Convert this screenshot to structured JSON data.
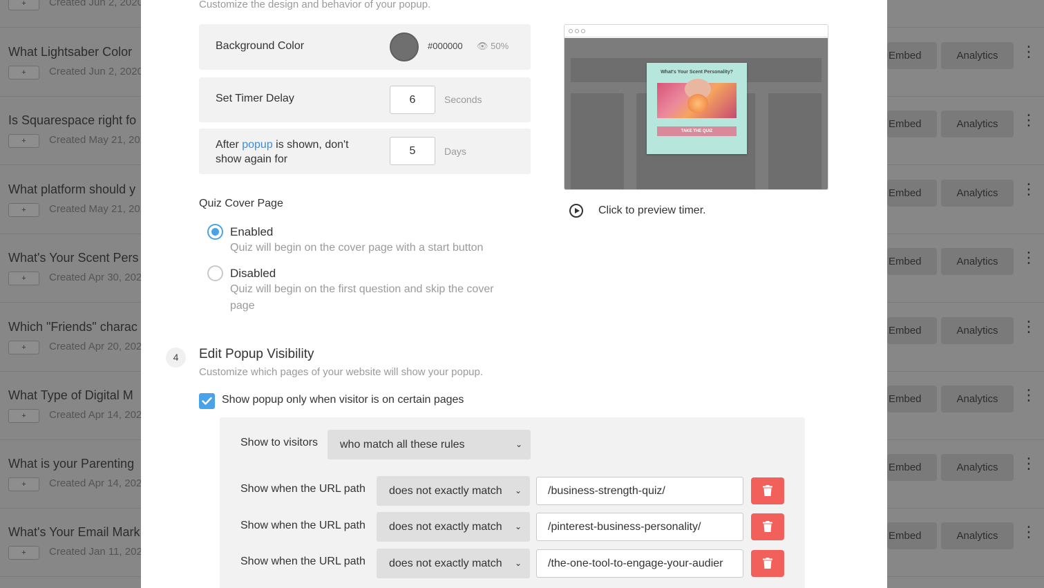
{
  "background_list": {
    "rows": [
      {
        "title": "",
        "tag": "+",
        "created": "Created Jun 2, 2020",
        "embed": "",
        "analytics": ""
      },
      {
        "title": "What Lightsaber Color",
        "tag": "+",
        "created": "Created Jun 2, 2020",
        "embed": "Embed",
        "analytics": "Analytics"
      },
      {
        "title": "Is Squarespace right fo",
        "tag": "+",
        "created": "Created May 21, 202",
        "embed": "Embed",
        "analytics": "Analytics"
      },
      {
        "title": "What platform should y",
        "tag": "+",
        "created": "Created May 21, 202",
        "embed": "Embed",
        "analytics": "Analytics"
      },
      {
        "title": "What's Your Scent Pers",
        "tag": "+",
        "created": "Created Apr 30, 202",
        "embed": "Embed",
        "analytics": "Analytics"
      },
      {
        "title": "Which \"Friends\" charac",
        "tag": "+",
        "created": "Created Apr 20, 202",
        "embed": "Embed",
        "analytics": "Analytics"
      },
      {
        "title": "What Type of Digital M",
        "tag": "+",
        "created": "Created Apr 14, 202",
        "embed": "Embed",
        "analytics": "Analytics"
      },
      {
        "title": "What is your Parenting",
        "tag": "+",
        "created": "Created Apr 14, 202",
        "embed": "Embed",
        "analytics": "Analytics"
      },
      {
        "title": "What's Your Email Mark",
        "tag": "+",
        "created": "Created Jan 11, 2020",
        "embed": "Embed",
        "analytics": "Analytics"
      }
    ],
    "more_icon": "vertical-dots-icon"
  },
  "design": {
    "subtitle": "Customize the design and behavior of your popup.",
    "background_color": {
      "label": "Background Color",
      "hex": "#000000",
      "opacity": "50%",
      "swatch_color": "#6f6f6f"
    },
    "timer_delay": {
      "label": "Set Timer Delay",
      "value": "6",
      "unit": "Seconds"
    },
    "show_again": {
      "label_before": "After ",
      "label_link": "popup",
      "label_after": " is shown, don't show again for",
      "value": "5",
      "unit": "Days"
    },
    "cover_page": {
      "label": "Quiz Cover Page",
      "enabled": {
        "title": "Enabled",
        "desc": "Quiz will begin on the cover page with a start button"
      },
      "disabled": {
        "title": "Disabled",
        "desc": "Quiz will begin on the first question and skip the cover page"
      }
    }
  },
  "preview": {
    "popup_title": "What's Your Scent Personality?",
    "popup_button": "TAKE THE QUIZ",
    "link": "Click to preview timer."
  },
  "visibility": {
    "step": "4",
    "title": "Edit Popup Visibility",
    "subtitle": "Customize which pages of your website will show your popup.",
    "checkbox_label": "Show popup only when visitor is on certain pages",
    "show_to_label": "Show to visitors",
    "show_to_value": "who match all these rules",
    "rules": [
      {
        "label": "Show when the URL path",
        "match": "does not exactly match",
        "value": "/business-strength-quiz/"
      },
      {
        "label": "Show when the URL path",
        "match": "does not exactly match",
        "value": "/pinterest-business-personality/"
      },
      {
        "label": "Show when the URL path",
        "match": "does not exactly match",
        "value": "/the-one-tool-to-engage-your-audier"
      }
    ]
  },
  "colors": {
    "accent": "#4aa3e8",
    "danger": "#f1605a",
    "panel": "#f2f2f3"
  }
}
